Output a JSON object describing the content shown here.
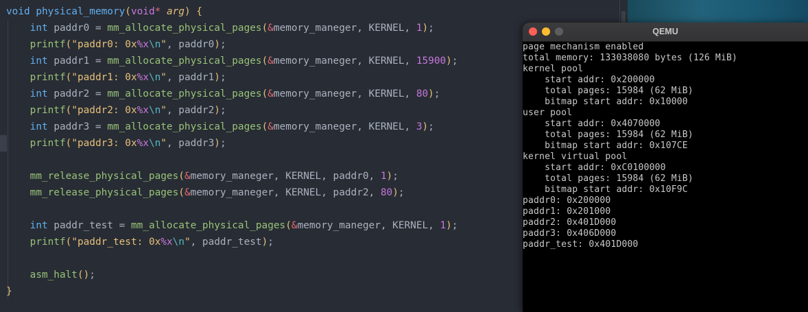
{
  "editor": {
    "lines": [
      {
        "segments": [
          [
            "kw",
            "void "
          ],
          [
            "fn",
            "physical_memory"
          ],
          [
            "br",
            "("
          ],
          [
            "vd",
            "void"
          ],
          [
            "op",
            "* "
          ],
          [
            "arg",
            "arg"
          ],
          [
            "br",
            ")"
          ],
          [
            "ident",
            " "
          ],
          [
            "br",
            "{"
          ]
        ]
      },
      {
        "segments": [
          [
            "ident",
            "    "
          ],
          [
            "kw",
            "int"
          ],
          [
            "ident",
            " paddr0 = "
          ],
          [
            "fnn",
            "mm_allocate_physical_pages"
          ],
          [
            "br",
            "("
          ],
          [
            "op",
            "&"
          ],
          [
            "ident",
            "memory_maneger, KERNEL, "
          ],
          [
            "num",
            "1"
          ],
          [
            "br",
            ")"
          ],
          [
            "ident",
            ";"
          ]
        ]
      },
      {
        "segments": [
          [
            "ident",
            "    "
          ],
          [
            "fnn",
            "printf"
          ],
          [
            "br",
            "("
          ],
          [
            "str",
            "\"paddr0: 0x"
          ],
          [
            "fmt",
            "%x"
          ],
          [
            "esc",
            "\\n"
          ],
          [
            "str",
            "\""
          ],
          [
            "ident",
            ", paddr0"
          ],
          [
            "br",
            ")"
          ],
          [
            "ident",
            ";"
          ]
        ]
      },
      {
        "segments": [
          [
            "ident",
            "    "
          ],
          [
            "kw",
            "int"
          ],
          [
            "ident",
            " paddr1 = "
          ],
          [
            "fnn",
            "mm_allocate_physical_pages"
          ],
          [
            "br",
            "("
          ],
          [
            "op",
            "&"
          ],
          [
            "ident",
            "memory_maneger, KERNEL, "
          ],
          [
            "num",
            "15900"
          ],
          [
            "br",
            ")"
          ],
          [
            "ident",
            ";"
          ]
        ]
      },
      {
        "segments": [
          [
            "ident",
            "    "
          ],
          [
            "fnn",
            "printf"
          ],
          [
            "br",
            "("
          ],
          [
            "str",
            "\"paddr1: 0x"
          ],
          [
            "fmt",
            "%x"
          ],
          [
            "esc",
            "\\n"
          ],
          [
            "str",
            "\""
          ],
          [
            "ident",
            ", paddr1"
          ],
          [
            "br",
            ")"
          ],
          [
            "ident",
            ";"
          ]
        ]
      },
      {
        "segments": [
          [
            "ident",
            "    "
          ],
          [
            "kw",
            "int"
          ],
          [
            "ident",
            " paddr2 = "
          ],
          [
            "fnn",
            "mm_allocate_physical_pages"
          ],
          [
            "br",
            "("
          ],
          [
            "op",
            "&"
          ],
          [
            "ident",
            "memory_maneger, KERNEL, "
          ],
          [
            "num",
            "80"
          ],
          [
            "br",
            ")"
          ],
          [
            "ident",
            ";"
          ]
        ]
      },
      {
        "segments": [
          [
            "ident",
            "    "
          ],
          [
            "fnn",
            "printf"
          ],
          [
            "br",
            "("
          ],
          [
            "str",
            "\"paddr2: 0x"
          ],
          [
            "fmt",
            "%x"
          ],
          [
            "esc",
            "\\n"
          ],
          [
            "str",
            "\""
          ],
          [
            "ident",
            ", paddr2"
          ],
          [
            "br",
            ")"
          ],
          [
            "ident",
            ";"
          ]
        ]
      },
      {
        "segments": [
          [
            "ident",
            "    "
          ],
          [
            "kw",
            "int"
          ],
          [
            "ident",
            " paddr3 = "
          ],
          [
            "fnn",
            "mm_allocate_physical_pages"
          ],
          [
            "br",
            "("
          ],
          [
            "op",
            "&"
          ],
          [
            "ident",
            "memory_maneger, KERNEL, "
          ],
          [
            "num",
            "3"
          ],
          [
            "br",
            ")"
          ],
          [
            "ident",
            ";"
          ]
        ]
      },
      {
        "segments": [
          [
            "ident",
            "    "
          ],
          [
            "fnn",
            "printf"
          ],
          [
            "br",
            "("
          ],
          [
            "str",
            "\"paddr3: 0x"
          ],
          [
            "fmt",
            "%x"
          ],
          [
            "esc",
            "\\n"
          ],
          [
            "str",
            "\""
          ],
          [
            "ident",
            ", paddr3"
          ],
          [
            "br",
            ")"
          ],
          [
            "ident",
            ";"
          ]
        ]
      },
      {
        "segments": []
      },
      {
        "segments": [
          [
            "ident",
            "    "
          ],
          [
            "fnn",
            "mm_release_physical_pages"
          ],
          [
            "br",
            "("
          ],
          [
            "op",
            "&"
          ],
          [
            "ident",
            "memory_maneger, KERNEL, paddr0, "
          ],
          [
            "num",
            "1"
          ],
          [
            "br",
            ")"
          ],
          [
            "ident",
            ";"
          ]
        ]
      },
      {
        "segments": [
          [
            "ident",
            "    "
          ],
          [
            "fnn",
            "mm_release_physical_pages"
          ],
          [
            "br",
            "("
          ],
          [
            "op",
            "&"
          ],
          [
            "ident",
            "memory_maneger, KERNEL, paddr2, "
          ],
          [
            "num",
            "80"
          ],
          [
            "br",
            ")"
          ],
          [
            "ident",
            ";"
          ]
        ]
      },
      {
        "segments": []
      },
      {
        "segments": [
          [
            "ident",
            "    "
          ],
          [
            "kw",
            "int"
          ],
          [
            "ident",
            " paddr_test = "
          ],
          [
            "fnn",
            "mm_allocate_physical_pages"
          ],
          [
            "br",
            "("
          ],
          [
            "op",
            "&"
          ],
          [
            "ident",
            "memory_maneger, KERNEL, "
          ],
          [
            "num",
            "1"
          ],
          [
            "br",
            ")"
          ],
          [
            "ident",
            ";"
          ]
        ]
      },
      {
        "segments": [
          [
            "ident",
            "    "
          ],
          [
            "fnn",
            "printf"
          ],
          [
            "br",
            "("
          ],
          [
            "str",
            "\"paddr_test: 0x"
          ],
          [
            "fmt",
            "%x"
          ],
          [
            "esc",
            "\\n"
          ],
          [
            "str",
            "\""
          ],
          [
            "ident",
            ", paddr_test"
          ],
          [
            "br",
            ")"
          ],
          [
            "ident",
            ";"
          ]
        ]
      },
      {
        "segments": []
      },
      {
        "segments": [
          [
            "ident",
            "    "
          ],
          [
            "fnn",
            "asm_halt"
          ],
          [
            "br",
            "()"
          ],
          [
            "ident",
            ";"
          ]
        ]
      },
      {
        "segments": [
          [
            "br",
            "}"
          ]
        ]
      }
    ]
  },
  "qemu": {
    "title": "QEMU",
    "console_lines": [
      "page mechanism enabled",
      "total memory: 133038080 bytes (126 MiB)",
      "kernel pool",
      "    start addr: 0x200000",
      "    total pages: 15984 (62 MiB)",
      "    bitmap start addr: 0x10000",
      "user pool",
      "    start addr: 0x4070000",
      "    total pages: 15984 (62 MiB)",
      "    bitmap start addr: 0x107CE",
      "kernel virtual pool",
      "    start addr: 0xC0100000",
      "    total pages: 15984 (62 MiB)",
      "    bitmap start addr: 0x10F9C",
      "paddr0: 0x200000",
      "paddr1: 0x201000",
      "paddr2: 0x401D000",
      "paddr3: 0x406D000",
      "paddr_test: 0x401D000"
    ]
  },
  "colors": {
    "editor_bg": "#282c34",
    "console_bg": "#000000",
    "console_fg": "#c9c9c9",
    "close": "#ff5f57",
    "minimize": "#febc2e",
    "maximize_inactive": "#5d5d5f"
  },
  "icons": {
    "close": "close-icon",
    "minimize": "minimize-icon",
    "maximize": "maximize-icon"
  }
}
